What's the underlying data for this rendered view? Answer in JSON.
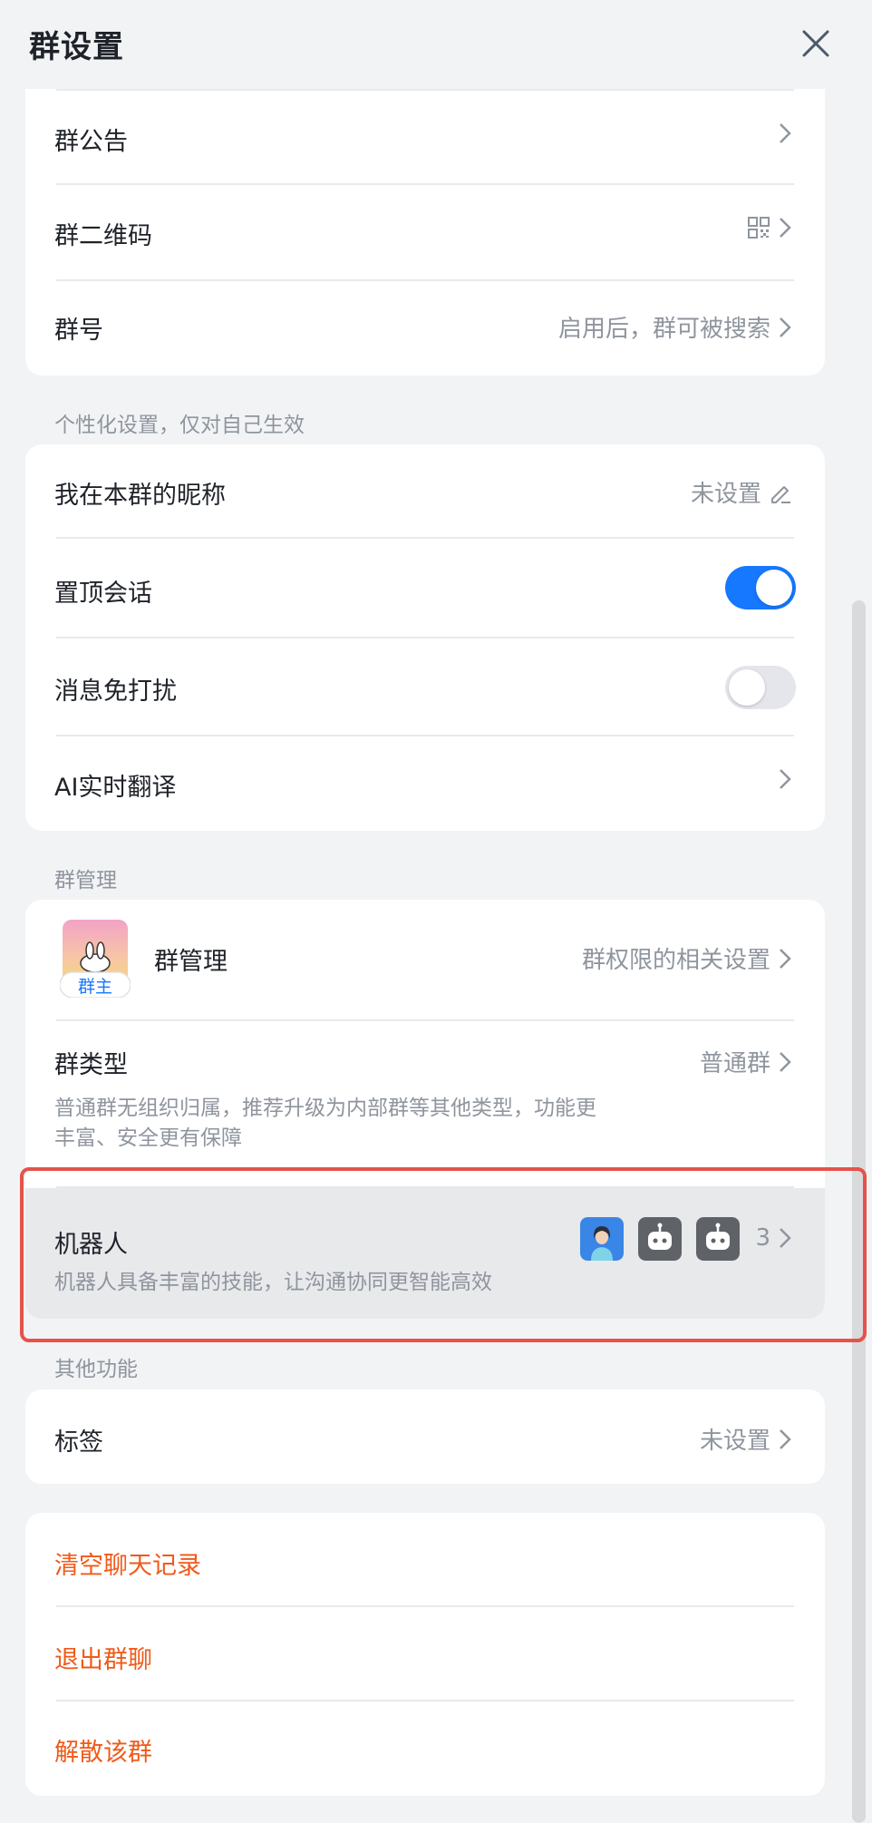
{
  "header": {
    "title": "群设置"
  },
  "group_info": {
    "announcement": "群公告",
    "qrcode": "群二维码",
    "group_number": "群号",
    "group_number_value": "启用后，群可被搜索"
  },
  "personal": {
    "section_title": "个性化设置，仅对自己生效",
    "nickname_label": "我在本群的昵称",
    "nickname_value": "未设置",
    "pin_label": "置顶会话",
    "pin_on": true,
    "mute_label": "消息免打扰",
    "mute_on": false,
    "translate_label": "AI实时翻译"
  },
  "management": {
    "section_title": "群管理",
    "manage_label": "群管理",
    "owner_badge": "群主",
    "manage_value": "群权限的相关设置",
    "type_label": "群类型",
    "type_value": "普通群",
    "type_desc_line1": "普通群无组织归属，推荐升级为内部群等其他类型，功能更",
    "type_desc_line2": "丰富、安全更有保障",
    "robot_label": "机器人",
    "robot_desc": "机器人具备丰富的技能，让沟通协同更智能高效",
    "robot_count": "3"
  },
  "other": {
    "section_title": "其他功能",
    "tag_label": "标签",
    "tag_value": "未设置"
  },
  "danger": {
    "clear": "清空聊天记录",
    "quit": "退出群聊",
    "dissolve": "解散该群"
  },
  "colors": {
    "accent": "#1677ff",
    "danger": "#f05a1a",
    "highlight": "#e5534b"
  }
}
